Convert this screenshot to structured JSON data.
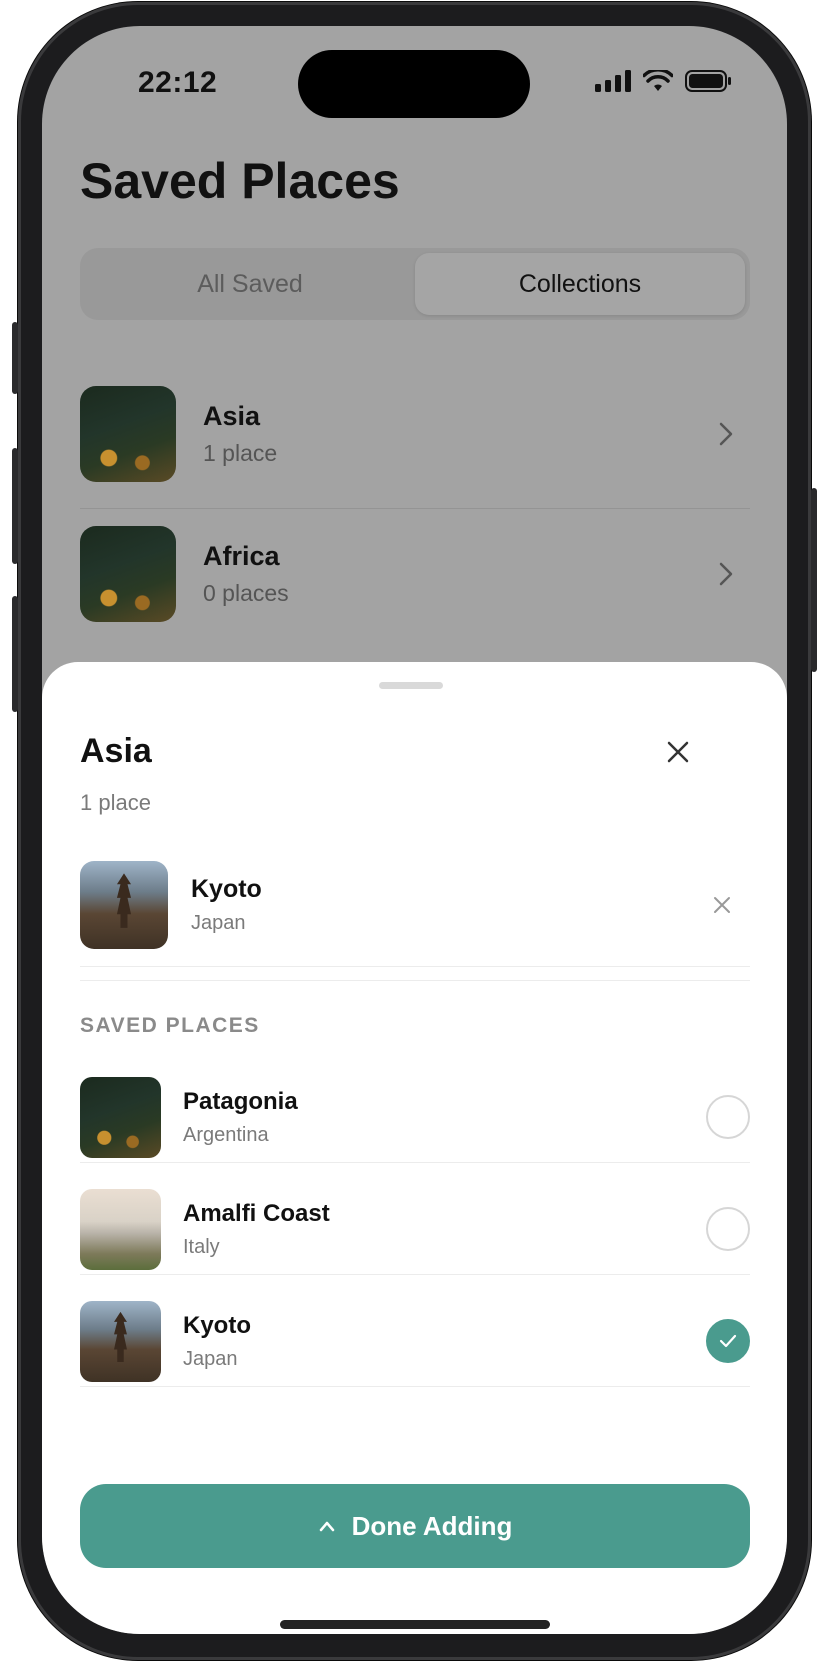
{
  "status_bar": {
    "time": "22:12"
  },
  "page": {
    "title": "Saved Places"
  },
  "tabs": [
    {
      "label": "All Saved",
      "active": false
    },
    {
      "label": "Collections",
      "active": true
    }
  ],
  "collections": [
    {
      "name": "Asia",
      "count": "1 place",
      "image": "forest"
    },
    {
      "name": "Africa",
      "count": "0 places",
      "image": "forest"
    }
  ],
  "sheet": {
    "title": "Asia",
    "subtitle": "1 place",
    "current_items": [
      {
        "name": "Kyoto",
        "country": "Japan",
        "image": "kyoto"
      }
    ],
    "section_header": "SAVED PLACES",
    "places": [
      {
        "name": "Patagonia",
        "country": "Argentina",
        "image": "forest",
        "selected": false
      },
      {
        "name": "Amalfi Coast",
        "country": "Italy",
        "image": "amalfi",
        "selected": false
      },
      {
        "name": "Kyoto",
        "country": "Japan",
        "image": "kyoto",
        "selected": true
      }
    ],
    "done_label": "Done Adding"
  },
  "colors": {
    "accent": "#4a9b8e",
    "dim_overlay": "#a3a3a3"
  },
  "icons": [
    "signal-icon",
    "wifi-icon",
    "battery-icon",
    "chevron-right-icon",
    "close-icon",
    "check-icon",
    "chevron-up-icon"
  ]
}
